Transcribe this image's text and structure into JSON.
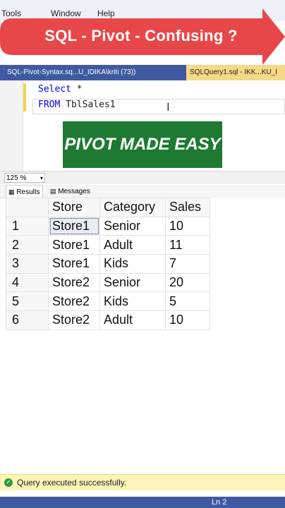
{
  "menu": [
    "Tools",
    "Window",
    "Help"
  ],
  "banner": {
    "text": "SQL - Pivot - Confusing ?"
  },
  "tabs": [
    {
      "label": "SQL-Pivot-Syntax.sq...U_IDIKA\\kriti (73))"
    },
    {
      "label": "SQLQuery1.sql - IKK...KU_I"
    }
  ],
  "code": {
    "line1_kw": "Select",
    "line1_rest": " *",
    "line2_kw": "FROM",
    "line2_rest": " TblSales1",
    "collapse_glyph": "⊟"
  },
  "overlay": {
    "text": "PIVOT MADE EASY"
  },
  "zoom": {
    "value": "125 %"
  },
  "results_tabs": [
    {
      "label": "Results",
      "icon": "grid-icon"
    },
    {
      "label": "Messages",
      "icon": "messages-icon"
    }
  ],
  "table": {
    "columns": [
      "Store",
      "Category",
      "Sales"
    ],
    "rows": [
      {
        "n": "1",
        "store": "Store1",
        "category": "Senior",
        "sales": "10"
      },
      {
        "n": "2",
        "store": "Store1",
        "category": "Adult",
        "sales": "11"
      },
      {
        "n": "3",
        "store": "Store1",
        "category": "Kids",
        "sales": "7"
      },
      {
        "n": "4",
        "store": "Store2",
        "category": "Senior",
        "sales": "20"
      },
      {
        "n": "5",
        "store": "Store2",
        "category": "Kids",
        "sales": "5"
      },
      {
        "n": "6",
        "store": "Store2",
        "category": "Adult",
        "sales": "10"
      }
    ]
  },
  "status": {
    "text": "Query executed successfully.",
    "icon": "check-icon"
  },
  "bottom": {
    "ln": "Ln 2"
  },
  "colors": {
    "banner": "#e8474a",
    "tab_bar": "#3f5aa0",
    "active_tab": "#f5d987",
    "overlay": "#1e7a32",
    "status_bar": "#fff3b8",
    "keyword": "#0000ff"
  }
}
